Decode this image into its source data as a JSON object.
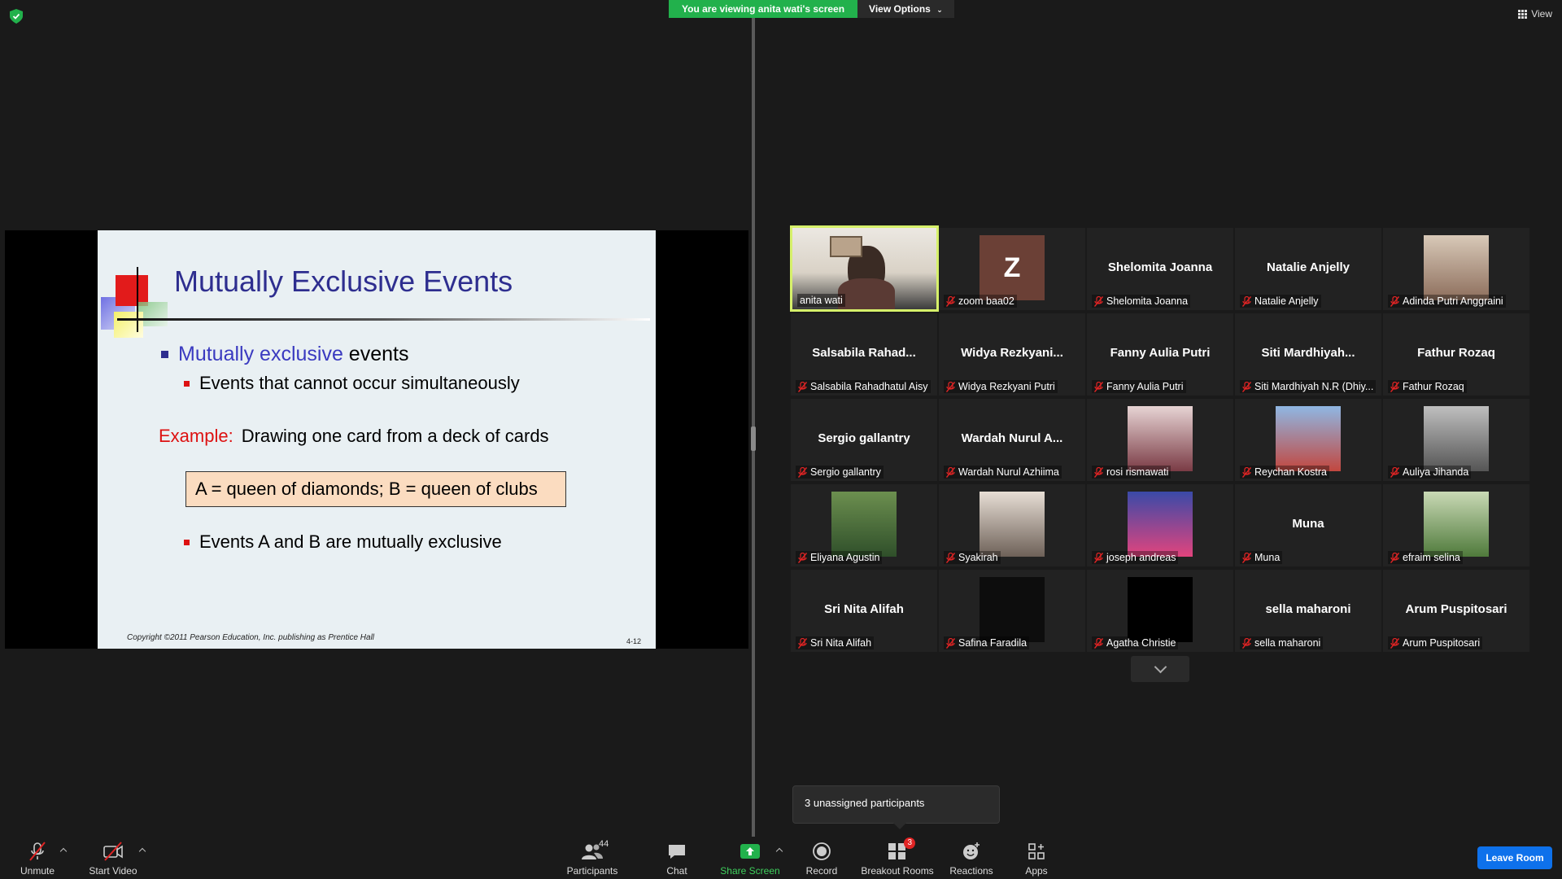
{
  "banner": {
    "viewing_text": "You are viewing anita wati's screen",
    "view_options": "View Options"
  },
  "top_right_view": "View",
  "slide": {
    "title": "Mutually Exclusive Events",
    "bullet1_blue": "Mutually exclusive",
    "bullet1_rest": " events",
    "bullet2": "Events that cannot occur simultaneously",
    "example_label": "Example:",
    "example_text": "Drawing one card from a deck of cards",
    "box_text": "A = queen of diamonds;  B = queen of clubs",
    "bullet3": "Events A and B are mutually exclusive",
    "copyright": "Copyright ©2011 Pearson Education, Inc. publishing as Prentice Hall",
    "slide_number": "4-12"
  },
  "gallery": {
    "tiles": [
      {
        "big": "",
        "label": "anita wati",
        "type": "video"
      },
      {
        "big": "",
        "label": "zoom baa02",
        "type": "avatar-z",
        "avatar_letter": "Z"
      },
      {
        "big": "Shelomita Joanna",
        "label": "Shelomita Joanna",
        "type": "name"
      },
      {
        "big": "Natalie Anjelly",
        "label": "Natalie Anjelly",
        "type": "name"
      },
      {
        "big": "",
        "label": "Adinda Putri Anggraini",
        "type": "photo"
      },
      {
        "big": "Salsabila  Rahad...",
        "label": "Salsabila Rahadhatul Aisy",
        "type": "name"
      },
      {
        "big": "Widya  Rezkyani...",
        "label": "Widya Rezkyani Putri",
        "type": "name"
      },
      {
        "big": "Fanny Aulia Putri",
        "label": "Fanny Aulia Putri",
        "type": "name"
      },
      {
        "big": "Siti  Mardhiyah...",
        "label": "Siti Mardhiyah N.R (Dhiy...",
        "type": "name"
      },
      {
        "big": "Fathur Rozaq",
        "label": "Fathur Rozaq",
        "type": "name"
      },
      {
        "big": "Sergio gallantry",
        "label": "Sergio gallantry",
        "type": "name"
      },
      {
        "big": "Wardah  Nurul  A...",
        "label": "Wardah Nurul Azhiima",
        "type": "name"
      },
      {
        "big": "",
        "label": "rosi rismawati",
        "type": "photo"
      },
      {
        "big": "",
        "label": "Reychan Kostra",
        "type": "photo"
      },
      {
        "big": "",
        "label": "Auliya Jihanda",
        "type": "photo"
      },
      {
        "big": "",
        "label": "Eliyana Agustin",
        "type": "photo"
      },
      {
        "big": "",
        "label": "Syakirah",
        "type": "photo"
      },
      {
        "big": "",
        "label": "joseph andreas",
        "type": "photo"
      },
      {
        "big": "Muna",
        "label": "Muna",
        "type": "name"
      },
      {
        "big": "",
        "label": "efraim selina",
        "type": "photo"
      },
      {
        "big": "Sri Nita Alifah",
        "label": "Sri Nita Alifah",
        "type": "name"
      },
      {
        "big": "",
        "label": "Safina Faradila",
        "type": "photo"
      },
      {
        "big": "",
        "label": "Agatha Christie",
        "type": "photo"
      },
      {
        "big": "sella maharoni",
        "label": "sella maharoni",
        "type": "name"
      },
      {
        "big": "Arum Puspitosari",
        "label": "Arum Puspitosari",
        "type": "name"
      }
    ]
  },
  "unassigned_text": "3 unassigned participants",
  "toolbar": {
    "unmute": "Unmute",
    "start_video": "Start Video",
    "participants": "Participants",
    "participants_count": "44",
    "chat": "Chat",
    "share_screen": "Share Screen",
    "record": "Record",
    "breakout_rooms": "Breakout Rooms",
    "breakout_badge": "3",
    "reactions": "Reactions",
    "apps": "Apps",
    "leave": "Leave Room"
  },
  "colors": {
    "share_green": "#22b14c",
    "active_speaker": "#d6f06a",
    "leave_blue": "#0e71eb",
    "slide_title": "#2e2e8f",
    "mic_red": "#e02424"
  }
}
